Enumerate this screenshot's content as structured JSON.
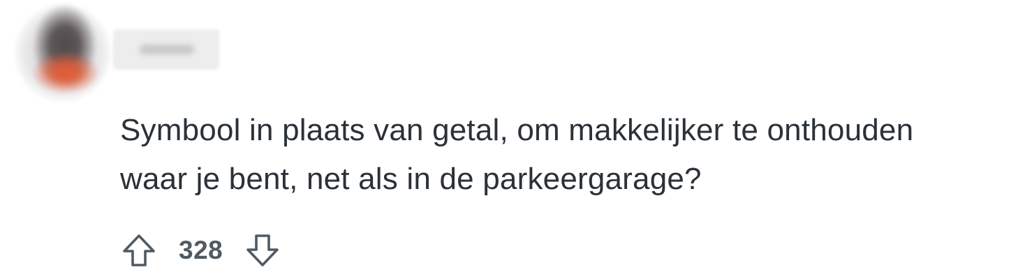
{
  "comment": {
    "author_name": "",
    "body_line_1": "Symbool in plaats van getal, om makkelijker te onthouden",
    "body_line_2": "waar je bent, net als in de parkeergarage?",
    "vote_score": "328"
  },
  "icons": {
    "upvote": "arrow-up-outline-icon",
    "downvote": "arrow-down-outline-icon"
  },
  "colors": {
    "text": "#2a3138",
    "meta": "#505a62",
    "avatar_accent": "#e25a35"
  }
}
